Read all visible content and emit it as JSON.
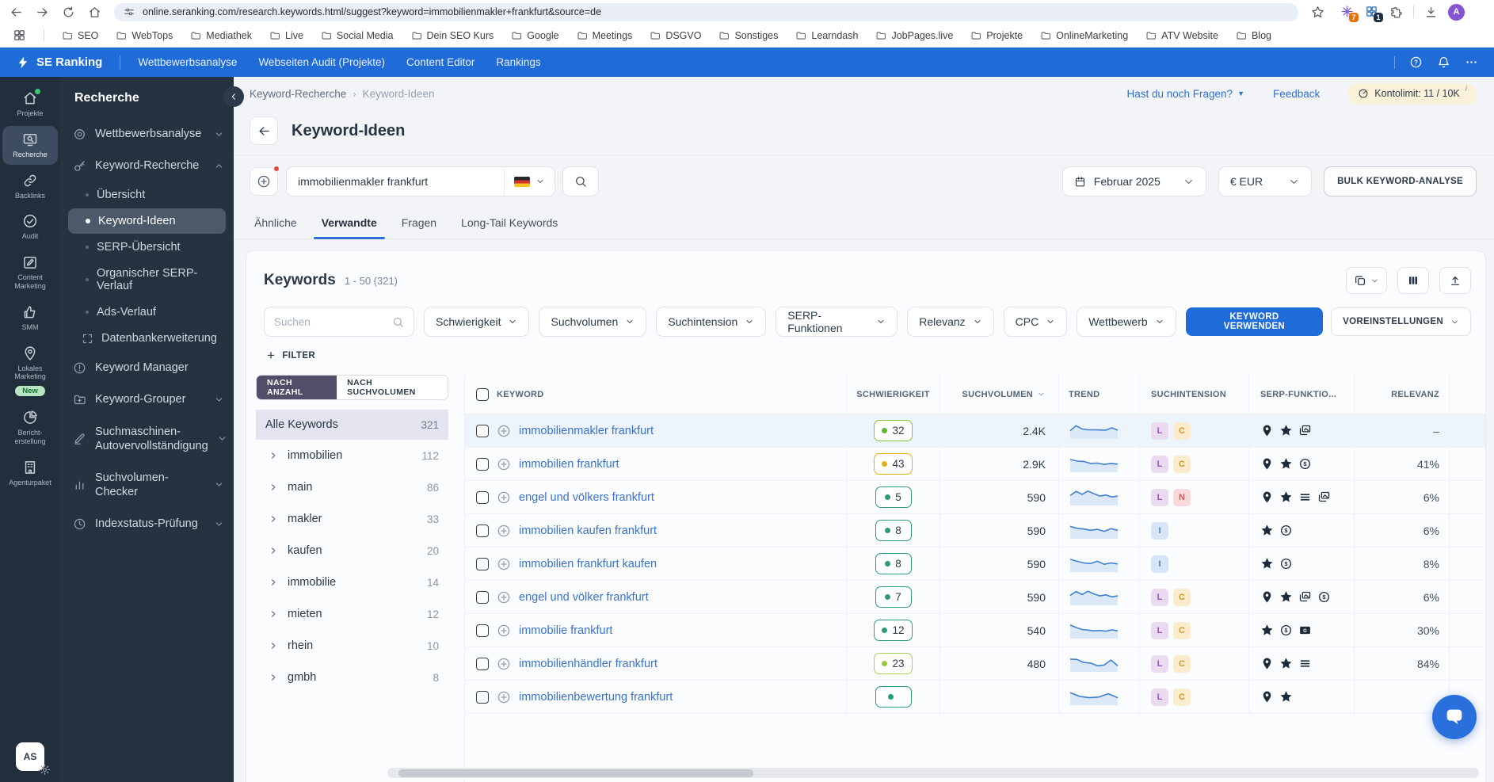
{
  "browser": {
    "url": "online.seranking.com/research.keywords.html/suggest?keyword=immobilienmakler+frankfurt&source=de",
    "bookmarks": [
      "SEO",
      "WebTops",
      "Mediathek",
      "Live",
      "Social Media",
      "Dein SEO Kurs",
      "Google",
      "Meetings",
      "DSGVO",
      "Sonstiges",
      "Learndash",
      "JobPages.live",
      "Projekte",
      "OnlineMarketing",
      "ATV Website",
      "Blog"
    ],
    "extension_badges": [
      "7",
      "1"
    ],
    "profile_initial": "A"
  },
  "topnav": {
    "brand": "SE Ranking",
    "items": [
      "Wettbewerbsanalyse",
      "Webseiten Audit (Projekte)",
      "Content Editor",
      "Rankings"
    ]
  },
  "rail": {
    "items": [
      {
        "icon": "home",
        "label": "Projekte",
        "dot": true
      },
      {
        "icon": "monitor-search",
        "label": "Recherche",
        "active": true
      },
      {
        "icon": "link",
        "label": "Backlinks"
      },
      {
        "icon": "check-circle",
        "label": "Audit"
      },
      {
        "icon": "edit",
        "label": "Content Marketing"
      },
      {
        "icon": "thumb-up",
        "label": "SMM"
      },
      {
        "icon": "map-pin",
        "label": "Lokales Marketing",
        "badge": "New"
      },
      {
        "icon": "pie-chart",
        "label": "Bericht-erstellung"
      },
      {
        "icon": "building",
        "label": "Agenturpaket"
      }
    ],
    "user_initials": "AS"
  },
  "sidenav": {
    "title": "Recherche",
    "items": [
      {
        "icon": "target",
        "label": "Wettbewerbsanalyse",
        "chevron": "down"
      },
      {
        "icon": "key",
        "label": "Keyword-Recherche",
        "chevron": "up",
        "children": [
          {
            "label": "Übersicht"
          },
          {
            "label": "Keyword-Ideen",
            "active": true
          },
          {
            "label": "SERP-Übersicht"
          },
          {
            "label": "Organischer SERP-Verlauf"
          },
          {
            "label": "Ads-Verlauf"
          },
          {
            "label": "Datenbankerweiterung",
            "icon": "expand"
          }
        ]
      },
      {
        "icon": "alert-circle",
        "label": "Keyword Manager"
      },
      {
        "icon": "folder-plus",
        "label": "Keyword-Grouper",
        "chevron": "down"
      },
      {
        "icon": "pencil",
        "label": "Suchmaschinen-Autovervollständigung",
        "chevron": "down"
      },
      {
        "icon": "bar-chart",
        "label": "Suchvolumen-Checker",
        "chevron": "down"
      },
      {
        "icon": "clock",
        "label": "Indexstatus-Prüfung",
        "chevron": "down"
      }
    ]
  },
  "header": {
    "breadcrumb": [
      "Keyword-Recherche",
      "Keyword-Ideen"
    ],
    "questions_label": "Hast du noch Fragen?",
    "feedback_label": "Feedback",
    "limit_label": "Kontolimit: 11 / 10K"
  },
  "toolbar": {
    "page_title": "Keyword-Ideen",
    "search_value": "immobilienmakler frankfurt",
    "date_label": "Februar 2025",
    "currency_label": "€ EUR",
    "bulk_label": "BULK KEYWORD-ANALYSE"
  },
  "tabs": {
    "items": [
      "Ähnliche",
      "Verwandte",
      "Fragen",
      "Long-Tail Keywords"
    ],
    "active_index": 1
  },
  "card": {
    "title": "Keywords",
    "range": "1 - 50 (321)",
    "filters": {
      "search_placeholder": "Suchen",
      "pills": [
        "Schwierigkeit",
        "Suchvolumen",
        "Suchintension",
        "SERP-Funktionen",
        "Relevanz",
        "CPC",
        "Wettbewerb"
      ],
      "use_keyword_label": "KEYWORD VERWENDEN",
      "presets_label": "VOREINSTELLUNGEN",
      "add_filter_label": "FILTER"
    },
    "groups": {
      "toggle": [
        "NACH ANZAHL",
        "NACH SUCHVOLUMEN"
      ],
      "toggle_active_index": 0,
      "all": {
        "label": "Alle Keywords",
        "count": "321"
      },
      "items": [
        {
          "label": "immobilien",
          "count": "112"
        },
        {
          "label": "main",
          "count": "86"
        },
        {
          "label": "makler",
          "count": "33"
        },
        {
          "label": "kaufen",
          "count": "20"
        },
        {
          "label": "immobilie",
          "count": "14"
        },
        {
          "label": "mieten",
          "count": "12"
        },
        {
          "label": "rhein",
          "count": "10"
        },
        {
          "label": "gmbh",
          "count": "8"
        }
      ]
    },
    "table": {
      "columns": [
        "KEYWORD",
        "SCHWIERIGKEIT",
        "SUCHVOLUMEN",
        "TREND",
        "SUCHINTENSION",
        "SERP-FUNKTIO...",
        "RELEVANZ"
      ],
      "rows": [
        {
          "keyword": "immobilienmakler frankfurt",
          "difficulty": "32",
          "difficulty_level": "green",
          "volume": "2.4K",
          "trend": [
            45,
            75,
            55,
            50,
            50,
            49,
            48,
            62,
            48
          ],
          "intents": [
            "L",
            "C"
          ],
          "serp_features": [
            "pin",
            "star",
            "images"
          ],
          "relevance": "–",
          "highlighted": true
        },
        {
          "keyword": "immobilien frankfurt",
          "difficulty": "43",
          "difficulty_level": "yellow",
          "volume": "2.9K",
          "trend": [
            72,
            62,
            60,
            48,
            50,
            42,
            48,
            44
          ],
          "intents": [
            "L",
            "C"
          ],
          "serp_features": [
            "pin",
            "star",
            "dollar"
          ],
          "relevance": "41%"
        },
        {
          "keyword": "engel und völkers frankfurt",
          "difficulty": "5",
          "difficulty_level": "teal",
          "volume": "590",
          "trend": [
            55,
            80,
            62,
            82,
            66,
            52,
            58,
            46,
            52
          ],
          "intents": [
            "L",
            "N"
          ],
          "serp_features": [
            "pin",
            "star",
            "list",
            "images"
          ],
          "relevance": "6%"
        },
        {
          "keyword": "immobilien kaufen frankfurt",
          "difficulty": "8",
          "difficulty_level": "teal",
          "volume": "590",
          "trend": [
            70,
            58,
            54,
            46,
            52,
            40,
            56,
            46
          ],
          "intents": [
            "I"
          ],
          "serp_features": [
            "star",
            "dollar"
          ],
          "relevance": "6%"
        },
        {
          "keyword": "immobilien frankfurt kaufen",
          "difficulty": "8",
          "difficulty_level": "teal",
          "volume": "590",
          "trend": [
            72,
            60,
            50,
            46,
            60,
            42,
            50,
            44
          ],
          "intents": [
            "I"
          ],
          "serp_features": [
            "star",
            "dollar"
          ],
          "relevance": "8%"
        },
        {
          "keyword": "engel und völker frankfurt",
          "difficulty": "7",
          "difficulty_level": "teal",
          "volume": "590",
          "trend": [
            55,
            78,
            60,
            80,
            64,
            52,
            58,
            46,
            52
          ],
          "intents": [
            "L",
            "C"
          ],
          "serp_features": [
            "pin",
            "star",
            "images",
            "dollar"
          ],
          "relevance": "6%"
        },
        {
          "keyword": "immobilie frankfurt",
          "difficulty": "12",
          "difficulty_level": "teal",
          "volume": "540",
          "trend": [
            76,
            62,
            50,
            46,
            42,
            44,
            40,
            48,
            42
          ],
          "intents": [
            "L",
            "C"
          ],
          "serp_features": [
            "star",
            "dollar",
            "ads"
          ],
          "relevance": "30%"
        },
        {
          "keyword": "immobilienhändler frankfurt",
          "difficulty": "23",
          "difficulty_level": "lime",
          "volume": "480",
          "trend": [
            72,
            70,
            52,
            48,
            32,
            36,
            66,
            32
          ],
          "intents": [
            "L",
            "C"
          ],
          "serp_features": [
            "pin",
            "star",
            "list"
          ],
          "relevance": "84%"
        },
        {
          "keyword": "immobilienbewertung frankfurt",
          "difficulty": "",
          "difficulty_level": "teal",
          "volume": "",
          "trend": [
            70,
            48,
            40,
            44,
            64,
            40
          ],
          "intents": [
            "L",
            "C"
          ],
          "serp_features": [
            "pin",
            "star"
          ],
          "relevance": "",
          "partial": true
        }
      ]
    }
  },
  "colors": {
    "accent_blue": "#1f6cd9",
    "sidebar_dark": "#222e3c",
    "panel_dark": "#253240",
    "limit_pill_bg": "#faf1d8",
    "difficulty_green": "#86c440",
    "difficulty_yellow": "#e3b119",
    "difficulty_teal": "#2b9c77",
    "trend_line": "#4080d0"
  }
}
